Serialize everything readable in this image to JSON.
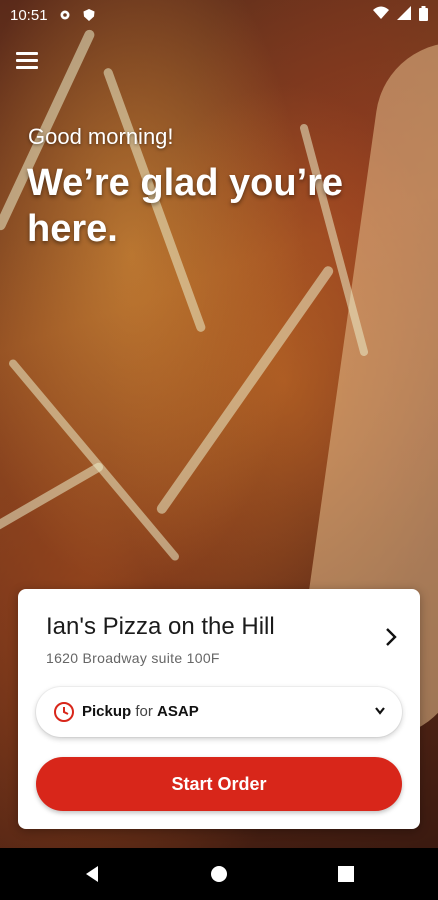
{
  "status_bar": {
    "time": "10:51",
    "left_icons": [
      "gear-icon",
      "shield-icon"
    ],
    "right_icons": [
      "wifi-icon",
      "signal-icon",
      "battery-icon"
    ]
  },
  "header": {
    "menu_icon": "hamburger-icon"
  },
  "hero": {
    "greeting": "Good morning!",
    "headline": "We’re glad you’re here."
  },
  "store_card": {
    "store_name": "Ian's Pizza on the Hill",
    "address": "1620 Broadway suite 100F",
    "pickup": {
      "mode": "Pickup",
      "connector": "for",
      "time": "ASAP"
    },
    "start_order_label": "Start Order"
  },
  "colors": {
    "accent": "#d8261a",
    "card_bg": "#ffffff"
  },
  "nav_bar": {
    "icons": [
      "back-icon",
      "home-icon",
      "recents-icon"
    ]
  }
}
